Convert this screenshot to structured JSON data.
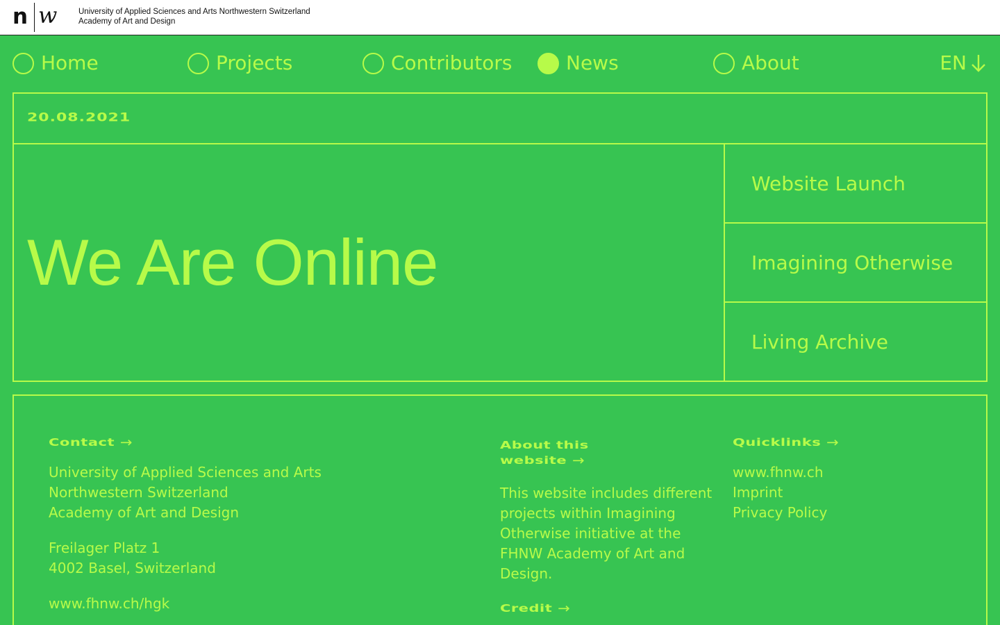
{
  "header": {
    "logo_n": "n",
    "logo_w": "w",
    "org_line1": "University of Applied Sciences and Arts Northwestern Switzerland",
    "org_line2": "Academy of Art and Design"
  },
  "nav": {
    "items": [
      {
        "label": "Home",
        "active": false
      },
      {
        "label": "Projects",
        "active": false
      },
      {
        "label": "Contributors",
        "active": false
      },
      {
        "label": "News",
        "active": true
      },
      {
        "label": "About",
        "active": false
      }
    ],
    "lang": "EN"
  },
  "post": {
    "date": "20.08.2021",
    "title": "We Are Online",
    "tags": [
      "Website Launch",
      "Imagining Otherwise",
      "Living Archive"
    ]
  },
  "footer": {
    "contact": {
      "heading": "Contact",
      "line1": "University of Applied Sciences and Arts",
      "line2": "Northwestern Switzerland",
      "line3": "Academy of Art and Design",
      "street": "Freilager Platz 1",
      "city": "4002 Basel, Switzerland",
      "url": "www.fhnw.ch/hgk"
    },
    "about": {
      "heading_line1": "About this",
      "heading_line2": "website",
      "text": "This website includes different projects within Imagining Otherwise initiative at the FHNW Academy of Art and Design.",
      "credit": "Credit"
    },
    "quicklinks": {
      "heading": "Quicklinks",
      "links": [
        "www.fhnw.ch",
        "Imprint",
        "Privacy Policy"
      ]
    }
  },
  "colors": {
    "background": "#37c452",
    "accent": "#b7fb49",
    "topbar": "#ffffff"
  }
}
